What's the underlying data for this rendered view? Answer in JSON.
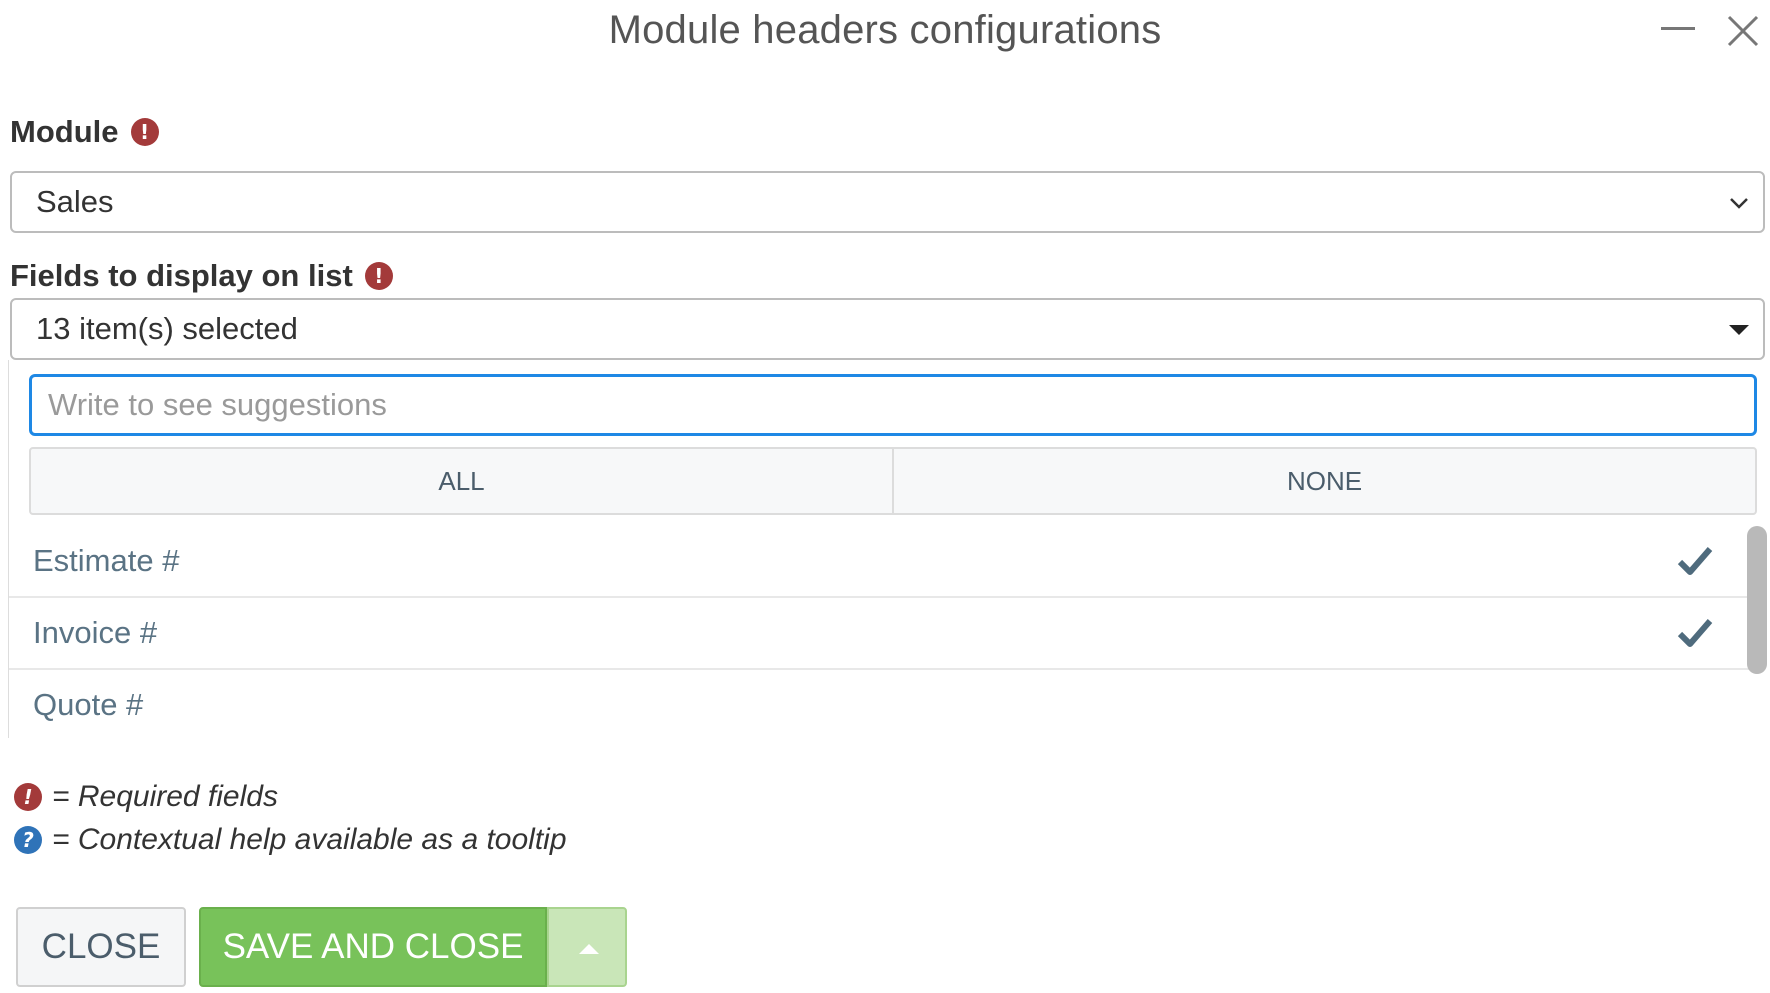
{
  "dialog": {
    "title": "Module headers configurations"
  },
  "module_field": {
    "label": "Module",
    "value": "Sales"
  },
  "fields_field": {
    "label": "Fields to display on list",
    "value": "13 item(s) selected"
  },
  "dropdown": {
    "search_placeholder": "Write to see suggestions",
    "search_value": "",
    "all_label": "ALL",
    "none_label": "NONE",
    "options": [
      {
        "label": "Estimate #",
        "checked": true
      },
      {
        "label": "Invoice #",
        "checked": true
      },
      {
        "label": "Quote #",
        "checked": false
      }
    ]
  },
  "legend": {
    "required": "= Required fields",
    "help": "= Contextual help available as a tooltip"
  },
  "buttons": {
    "close": "CLOSE",
    "save_and_close": "SAVE AND CLOSE"
  },
  "icons": {
    "required": "exclamation-circle-icon",
    "help": "question-circle-icon",
    "check": "check-icon"
  },
  "colors": {
    "required_red": "#a33a3a",
    "help_blue": "#2f73b8",
    "focus_blue": "#1e88e5",
    "save_green": "#78c25a",
    "option_text": "#5a7384"
  }
}
